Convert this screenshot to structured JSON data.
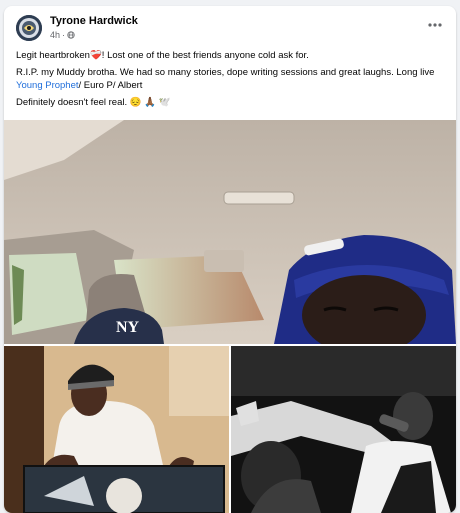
{
  "post": {
    "author": "Tyrone Hardwick",
    "time": "4h",
    "privacy_icon": "globe-icon",
    "more_icon": "more-options-icon",
    "line1_text": "Legit heartbroken",
    "line1_emoji": "❤️‍🩹",
    "line1_rest": "! Lost one of the best friends anyone cold ask for.",
    "line2_text": "R.I.P. my Muddy brotha. We had so many stories, dope writing sessions and great laughs. Long live ",
    "line2_link": "Young Prophet",
    "line2_rest": "/ Euro P/ Albert",
    "line3_text": "Definitely doesn't feel real.",
    "line3_emojis": "😔 🙏🏾 🕊️"
  },
  "photos": {
    "main": {
      "alt": "Selfie in car with two men wearing navy caps",
      "cap_text": "NY"
    },
    "bottom_left": {
      "alt": "Man in beanie and white t-shirt holding a framed artwork"
    },
    "bottom_right": {
      "alt": "Black and white photo of man pointing and rapping into a microphone"
    }
  },
  "colors": {
    "link": "#216fdb",
    "background": "#f0f2f5"
  }
}
